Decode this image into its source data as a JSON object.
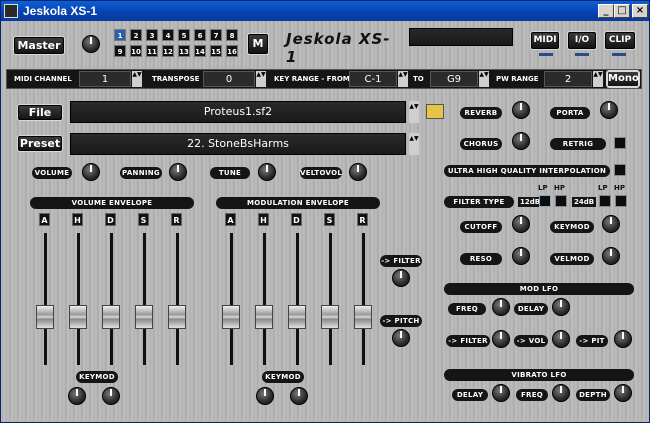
{
  "window": {
    "title": "Jeskola XS-1",
    "min": "_",
    "max": "□",
    "close": "×"
  },
  "header": {
    "master_label": "Master",
    "channels": [
      "1",
      "2",
      "3",
      "4",
      "5",
      "6",
      "7",
      "8",
      "9",
      "10",
      "11",
      "12",
      "13",
      "14",
      "15",
      "16"
    ],
    "m_label": "M",
    "logo": "Jeskola XS-1",
    "midi_label": "MIDI",
    "io_label": "I/O",
    "clip_label": "CLIP"
  },
  "bar": {
    "midi_channel_label": "MIDI CHANNEL",
    "midi_channel_value": "1",
    "transpose_label": "TRANSPOSE",
    "transpose_value": "0",
    "key_range_label": "KEY RANGE - FROM",
    "key_from": "C-1",
    "to_label": "TO",
    "key_to": "G9",
    "pw_range_label": "PW RANGE",
    "pw_value": "2",
    "mono_label": "Mono"
  },
  "file": {
    "label": "File",
    "value": "Proteus1.sf2"
  },
  "preset": {
    "label": "Preset",
    "value": "22. StoneBsHarms"
  },
  "knobs_row": {
    "volume": "VOLUME",
    "panning": "PANNING",
    "tune": "TUNE",
    "veltovol": "VELTOVOL"
  },
  "vol_env": {
    "title": "VOLUME ENVELOPE",
    "letters": [
      "A",
      "H",
      "D",
      "S",
      "R"
    ],
    "keymod": "KEYMOD"
  },
  "mod_env": {
    "title": "MODULATION ENVELOPE",
    "letters": [
      "A",
      "H",
      "D",
      "S",
      "R"
    ],
    "keymod": "KEYMOD",
    "filter": "-> FILTER",
    "pitch": "-> PITCH"
  },
  "right": {
    "reverb": "REVERB",
    "porta": "PORTA",
    "chorus": "CHORUS",
    "retrig": "RETRIG",
    "uhq": "ULTRA HIGH QUALITY INTERPOLATION",
    "filter_type": "FILTER TYPE",
    "db12": "12dB",
    "db24": "24dB",
    "lp": "LP",
    "hp": "HP",
    "cutoff": "CUTOFF",
    "keymod": "KEYMOD",
    "reso": "RESO",
    "velmod": "VELMOD"
  },
  "mod_lfo": {
    "title": "MOD LFO",
    "freq": "FREQ",
    "delay": "DELAY",
    "filter": "-> FILTER",
    "vol": "-> VOL",
    "pit": "-> PIT"
  },
  "vib_lfo": {
    "title": "VIBRATO LFO",
    "delay": "DELAY",
    "freq": "FREQ",
    "depth": "DEPTH"
  }
}
